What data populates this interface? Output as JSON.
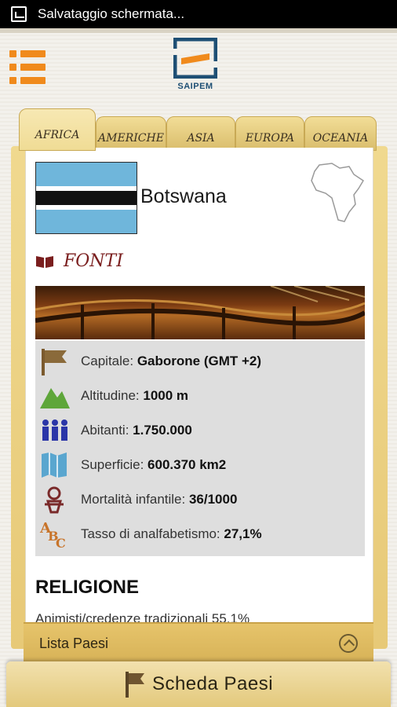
{
  "statusbar": {
    "notification": "Salvataggio schermata..."
  },
  "header": {
    "logo_text": "SAIPEM",
    "menu_icon": "hamburger-menu-icon"
  },
  "tabs": [
    {
      "label": "AFRICA",
      "active": true
    },
    {
      "label": "AMERICHE",
      "active": false
    },
    {
      "label": "ASIA",
      "active": false
    },
    {
      "label": "EUROPA",
      "active": false
    },
    {
      "label": "OCEANIA",
      "active": false
    }
  ],
  "country": {
    "name": "Botswana"
  },
  "sources": {
    "label": "FONTI"
  },
  "facts": [
    {
      "icon": "flag-icon",
      "label": "Capitale: ",
      "value": "Gaborone (GMT +2)"
    },
    {
      "icon": "mountain-icon",
      "label": "Altitudine: ",
      "value": "1000 m"
    },
    {
      "icon": "people-icon",
      "label": "Abitanti: ",
      "value": "1.750.000"
    },
    {
      "icon": "map-icon",
      "label": "Superficie: ",
      "value": "600.370 km2"
    },
    {
      "icon": "baby-icon",
      "label": "Mortalità infantile: ",
      "value": "36/1000"
    },
    {
      "icon": "abc-icon",
      "label": "Tasso di analfabetismo: ",
      "value": "27,1%"
    }
  ],
  "religion": {
    "title": "RELIGIONE",
    "text": "Animisti/credenze tradizionali 55,1%"
  },
  "bottom": {
    "list_label": "Lista Paesi",
    "sheet_label": "Scheda Paesi"
  },
  "colors": {
    "accent": "#f08a1c",
    "tab_gold": "#e7c977",
    "fonti_red": "#7a1e1e",
    "logo_blue": "#1e4f74",
    "info_bg": "#dedede"
  }
}
